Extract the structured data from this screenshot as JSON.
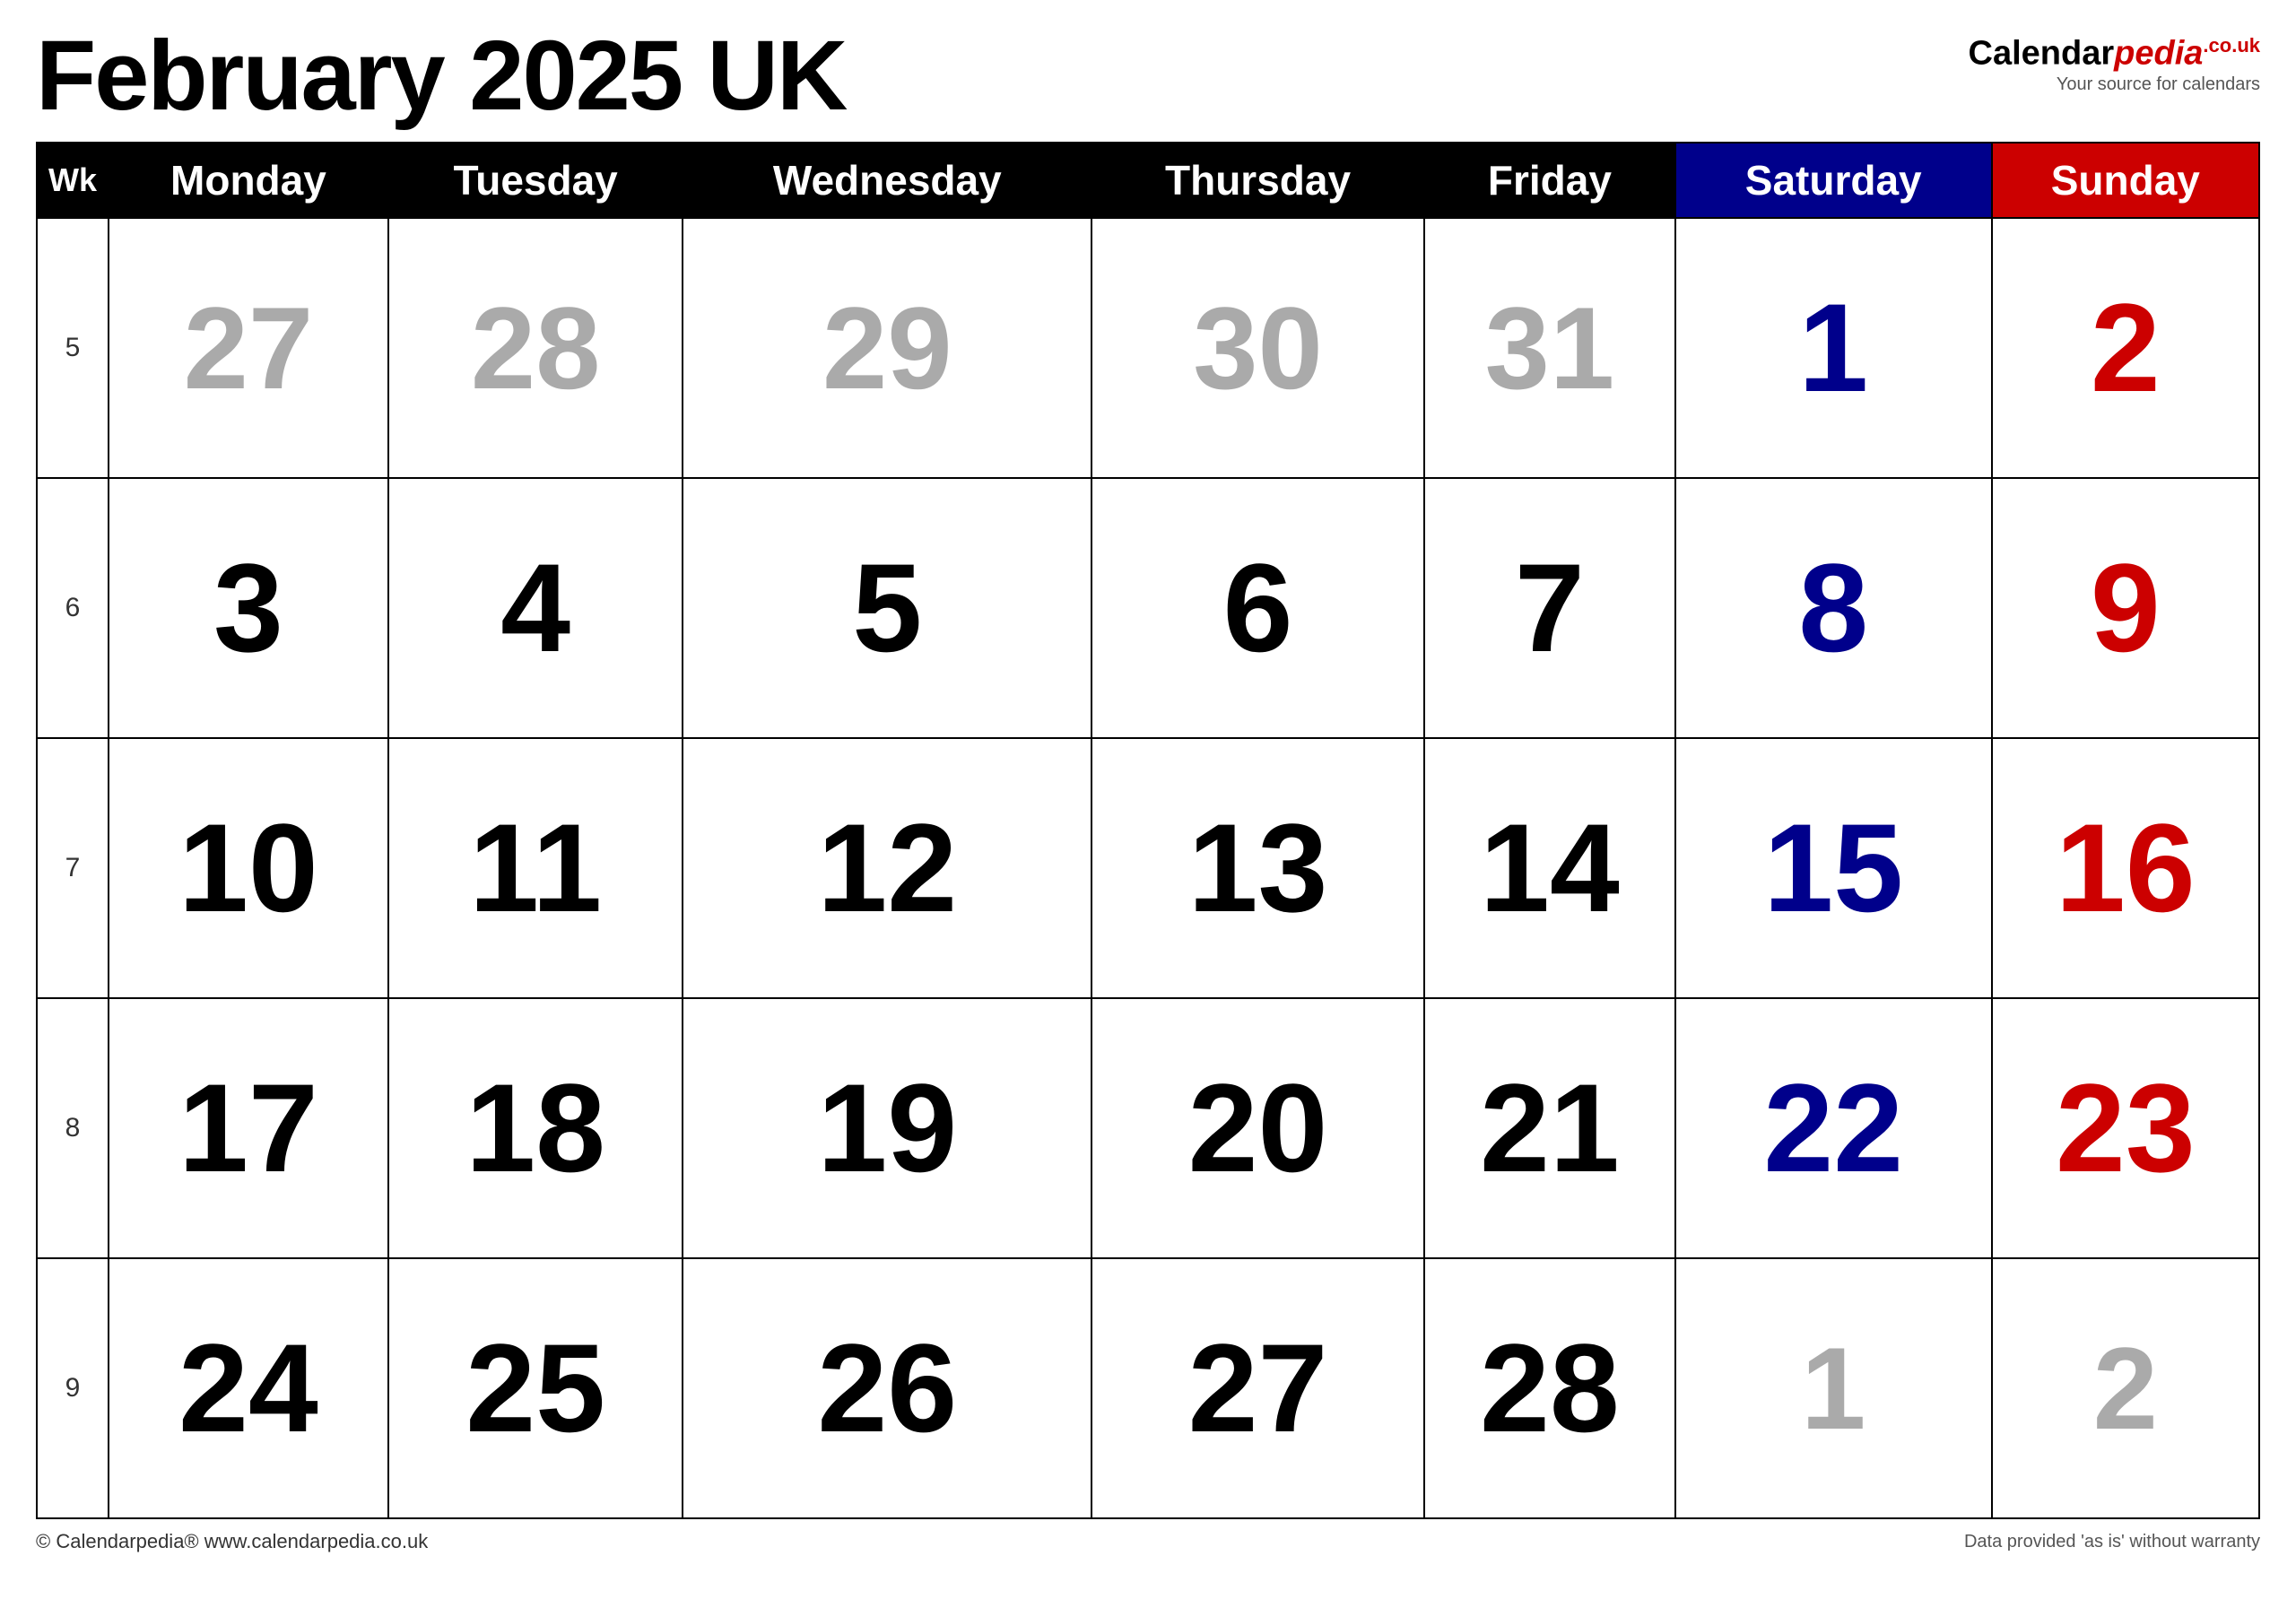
{
  "title": "February 2025 UK",
  "logo": {
    "brand": "Calendar",
    "brand_italic": "pedia",
    "domain": "co.uk",
    "tagline": "Your source for calendars"
  },
  "header": {
    "wk_label": "Wk",
    "days": [
      "Monday",
      "Tuesday",
      "Wednesday",
      "Thursday",
      "Friday",
      "Saturday",
      "Sunday"
    ]
  },
  "weeks": [
    {
      "wk": "5",
      "days": [
        {
          "num": "27",
          "type": "prev-month"
        },
        {
          "num": "28",
          "type": "prev-month"
        },
        {
          "num": "29",
          "type": "prev-month"
        },
        {
          "num": "30",
          "type": "prev-month"
        },
        {
          "num": "31",
          "type": "prev-month"
        },
        {
          "num": "1",
          "type": "saturday"
        },
        {
          "num": "2",
          "type": "sunday"
        }
      ]
    },
    {
      "wk": "6",
      "days": [
        {
          "num": "3",
          "type": "weekday"
        },
        {
          "num": "4",
          "type": "weekday"
        },
        {
          "num": "5",
          "type": "weekday"
        },
        {
          "num": "6",
          "type": "weekday"
        },
        {
          "num": "7",
          "type": "weekday"
        },
        {
          "num": "8",
          "type": "saturday"
        },
        {
          "num": "9",
          "type": "sunday"
        }
      ]
    },
    {
      "wk": "7",
      "days": [
        {
          "num": "10",
          "type": "weekday"
        },
        {
          "num": "11",
          "type": "weekday"
        },
        {
          "num": "12",
          "type": "weekday"
        },
        {
          "num": "13",
          "type": "weekday"
        },
        {
          "num": "14",
          "type": "weekday"
        },
        {
          "num": "15",
          "type": "saturday"
        },
        {
          "num": "16",
          "type": "sunday"
        }
      ]
    },
    {
      "wk": "8",
      "days": [
        {
          "num": "17",
          "type": "weekday"
        },
        {
          "num": "18",
          "type": "weekday"
        },
        {
          "num": "19",
          "type": "weekday"
        },
        {
          "num": "20",
          "type": "weekday"
        },
        {
          "num": "21",
          "type": "weekday"
        },
        {
          "num": "22",
          "type": "saturday"
        },
        {
          "num": "23",
          "type": "sunday"
        }
      ]
    },
    {
      "wk": "9",
      "days": [
        {
          "num": "24",
          "type": "weekday"
        },
        {
          "num": "25",
          "type": "weekday"
        },
        {
          "num": "26",
          "type": "weekday"
        },
        {
          "num": "27",
          "type": "weekday"
        },
        {
          "num": "28",
          "type": "weekday"
        },
        {
          "num": "1",
          "type": "next-month"
        },
        {
          "num": "2",
          "type": "next-month"
        }
      ]
    }
  ],
  "footer": {
    "left": "© Calendarpedia®  www.calendarpedia.co.uk",
    "right": "Data provided 'as is' without warranty"
  }
}
